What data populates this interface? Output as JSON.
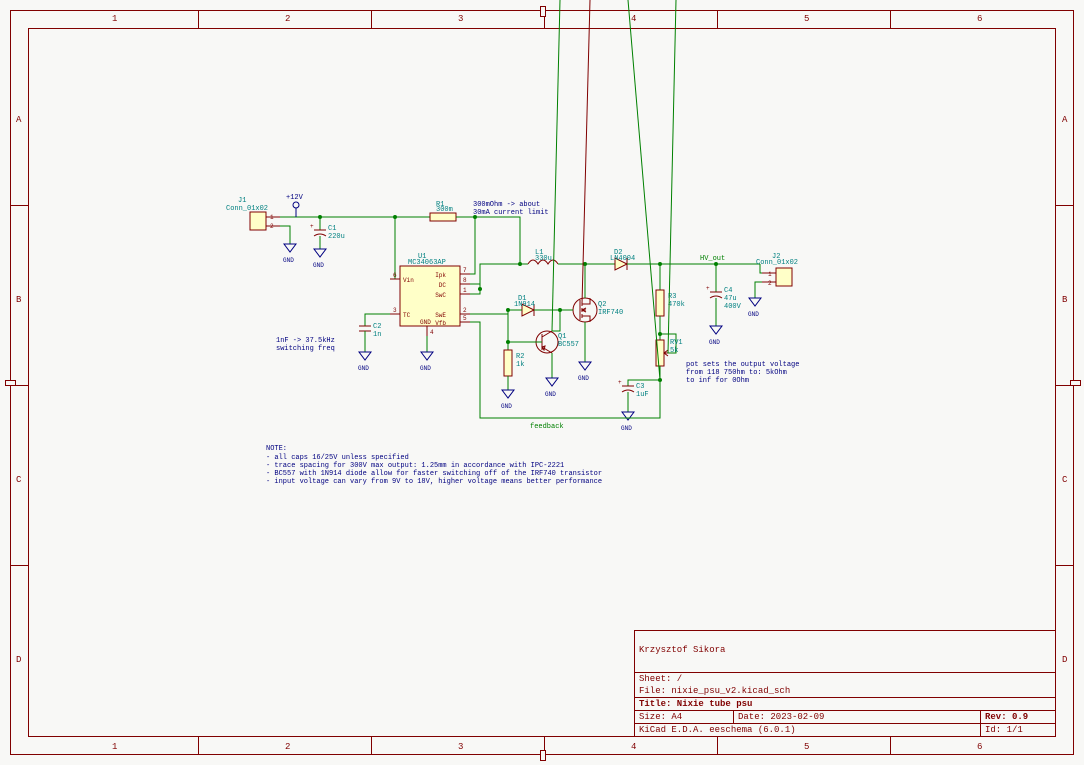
{
  "ruler_cols": [
    "1",
    "2",
    "3",
    "4",
    "5",
    "6"
  ],
  "ruler_rows": [
    "A",
    "B",
    "C",
    "D"
  ],
  "title_block": {
    "author": "Krzysztof Sikora",
    "sheet": "Sheet: /",
    "file": "File: nixie_psu_v2.kicad_sch",
    "title": "Title: Nixie tube psu",
    "size": "Size: A4",
    "date": "Date: 2023-02-09",
    "rev": "Rev: 0.9",
    "tool": "KiCad E.D.A.  eeschema (6.0.1)",
    "id": "Id: 1/1"
  },
  "power": {
    "p12": "+12V",
    "gnd": "GND",
    "hv": "HV_out"
  },
  "conn": {
    "j1": {
      "ref": "J1",
      "val": "Conn_01x02",
      "p1": "1",
      "p2": "2"
    },
    "j2": {
      "ref": "J2",
      "val": "Conn_01x02",
      "p1": "1",
      "p2": "2"
    }
  },
  "parts": {
    "c1": {
      "ref": "C1",
      "val": "220u"
    },
    "c2": {
      "ref": "C2",
      "val": "1n"
    },
    "c3": {
      "ref": "C3",
      "val": "1uF"
    },
    "c4": {
      "ref": "C4",
      "val": "47u"
    },
    "c4v": "400V",
    "r1": {
      "ref": "R1",
      "val": "300m"
    },
    "r2": {
      "ref": "R2",
      "val": "1k"
    },
    "r3": {
      "ref": "R3",
      "val": "470k"
    },
    "rv1": {
      "ref": "RV1",
      "val": "5k"
    },
    "l1": {
      "ref": "L1",
      "val": "330u"
    },
    "d1": {
      "ref": "D1",
      "val": "1N914"
    },
    "d2": {
      "ref": "D2",
      "val": "LN4004"
    },
    "q1": {
      "ref": "Q1",
      "val": "BC557"
    },
    "q2": {
      "ref": "Q2",
      "val": "IRF740"
    },
    "u1": {
      "ref": "U1",
      "val": "MC34063AP"
    }
  },
  "u1pins": {
    "p1": "SwC",
    "p2": "SwE",
    "p3": "TC",
    "p4": "GND",
    "p5": "Vfb",
    "p6": "Vin",
    "p7": "Ipk",
    "p8": "DC",
    "n1": "1",
    "n2": "2",
    "n3": "3",
    "n4": "4",
    "n5": "5",
    "n6": "6",
    "n7": "7",
    "n8": "8"
  },
  "annot": {
    "r1note": "300mOhm -> about\n30mA current limit",
    "c2note": "1nF -> 37.5kHz\nswitching freq",
    "rv1note": "pot sets the output voltage\nfrom 118 750hm to: 5kOhm\nto inf for 0Ohm",
    "fb": "feedback",
    "notes_hdr": "NOTE:",
    "notes": "- all caps 16/25V unless specified\n- trace spacing for 300V max output: 1.25mm in accordance with IPC-2221\n- BC557 with 1N914 diode allow for faster switching off of the IRF740 transistor\n- input voltage can vary from 9V to 18V, higher voltage means better performance"
  }
}
